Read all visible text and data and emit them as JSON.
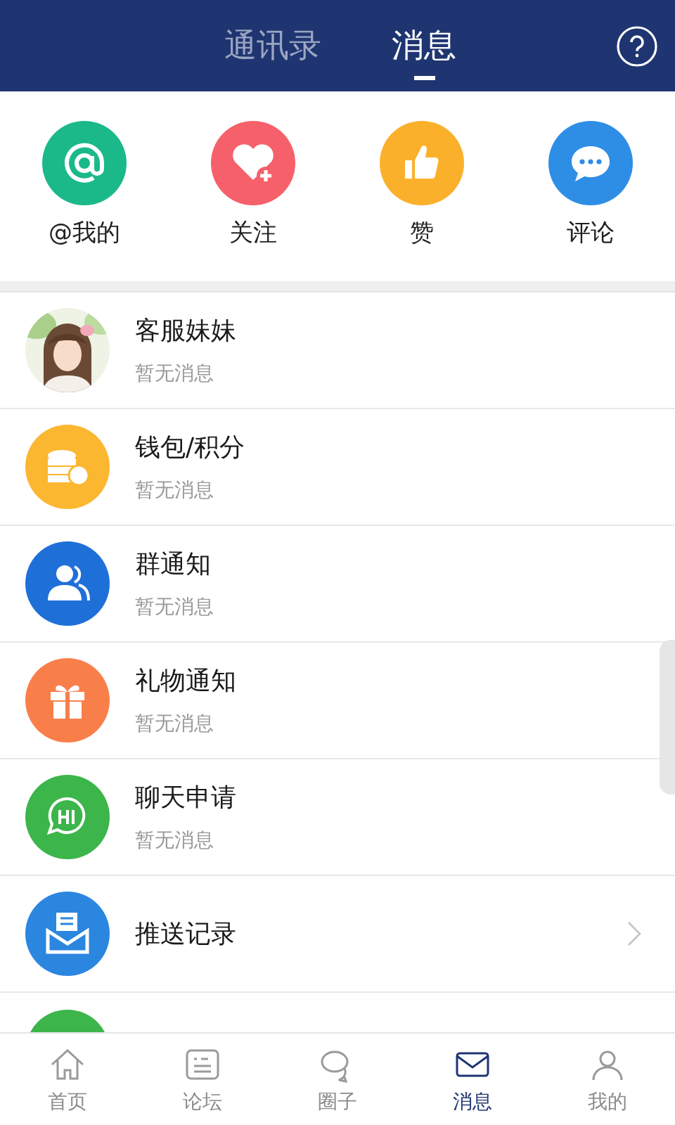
{
  "header": {
    "tabs": [
      {
        "label": "通讯录",
        "selected": false
      },
      {
        "label": "消息",
        "selected": true
      }
    ]
  },
  "quick_actions": [
    {
      "kind": "at",
      "label": "@我的"
    },
    {
      "kind": "follow",
      "label": "关注"
    },
    {
      "kind": "like",
      "label": "赞"
    },
    {
      "kind": "comment",
      "label": "评论"
    }
  ],
  "messages": [
    {
      "kind": "avatar",
      "title": "客服妹妹",
      "subtitle": "暂无消息"
    },
    {
      "kind": "wallet",
      "title": "钱包/积分",
      "subtitle": "暂无消息"
    },
    {
      "kind": "group",
      "title": "群通知",
      "subtitle": "暂无消息"
    },
    {
      "kind": "gift",
      "title": "礼物通知",
      "subtitle": "暂无消息"
    },
    {
      "kind": "chat",
      "title": "聊天申请",
      "subtitle": "暂无消息"
    },
    {
      "kind": "push",
      "title": "推送记录"
    },
    {
      "kind": "partial"
    }
  ],
  "bottom_nav": [
    {
      "kind": "home",
      "label": "首页",
      "selected": false
    },
    {
      "kind": "forum",
      "label": "论坛",
      "selected": false
    },
    {
      "kind": "circle",
      "label": "圈子",
      "selected": false
    },
    {
      "kind": "message",
      "label": "消息",
      "selected": true
    },
    {
      "kind": "me",
      "label": "我的",
      "selected": false
    }
  ]
}
